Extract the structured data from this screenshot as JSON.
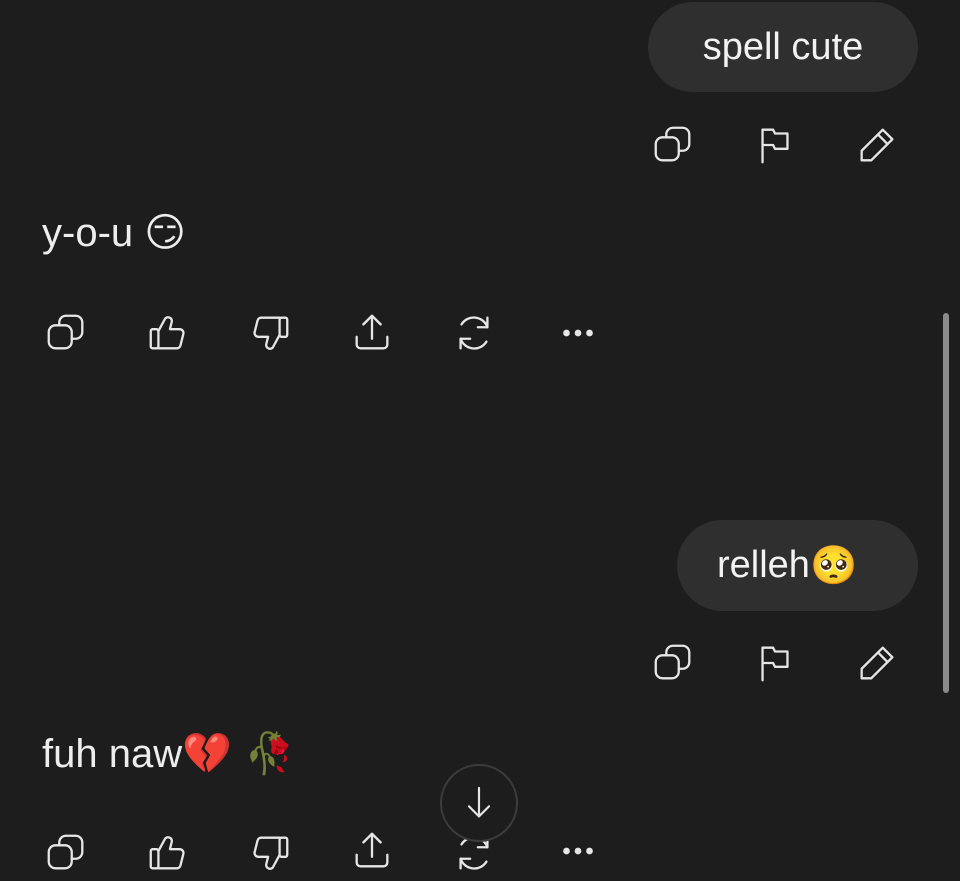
{
  "colors": {
    "background": "#1d1d1d",
    "user_bubble": "#2f2f2f",
    "text": "#ececec",
    "icon": "#e6e6e6",
    "scrollbar": "#8a8a8a"
  },
  "messages": [
    {
      "role": "user",
      "text": "spell cute",
      "actions": [
        "copy-icon",
        "flag-icon",
        "edit-icon"
      ]
    },
    {
      "role": "assistant",
      "text": "y-o-u",
      "emoji": "😏",
      "actions": [
        "copy-icon",
        "thumbs-up-icon",
        "thumbs-down-icon",
        "share-icon",
        "regenerate-icon",
        "more-icon"
      ]
    },
    {
      "role": "user",
      "text": "relleh",
      "emoji": "🥺",
      "actions": [
        "copy-icon",
        "flag-icon",
        "edit-icon"
      ]
    },
    {
      "role": "assistant",
      "text": "fuh naw",
      "emoji": "💔 🥀",
      "actions": [
        "copy-icon",
        "thumbs-up-icon",
        "thumbs-down-icon",
        "share-icon",
        "regenerate-icon",
        "more-icon"
      ]
    }
  ],
  "scroll_down_button": {
    "icon": "arrow-down-icon"
  }
}
